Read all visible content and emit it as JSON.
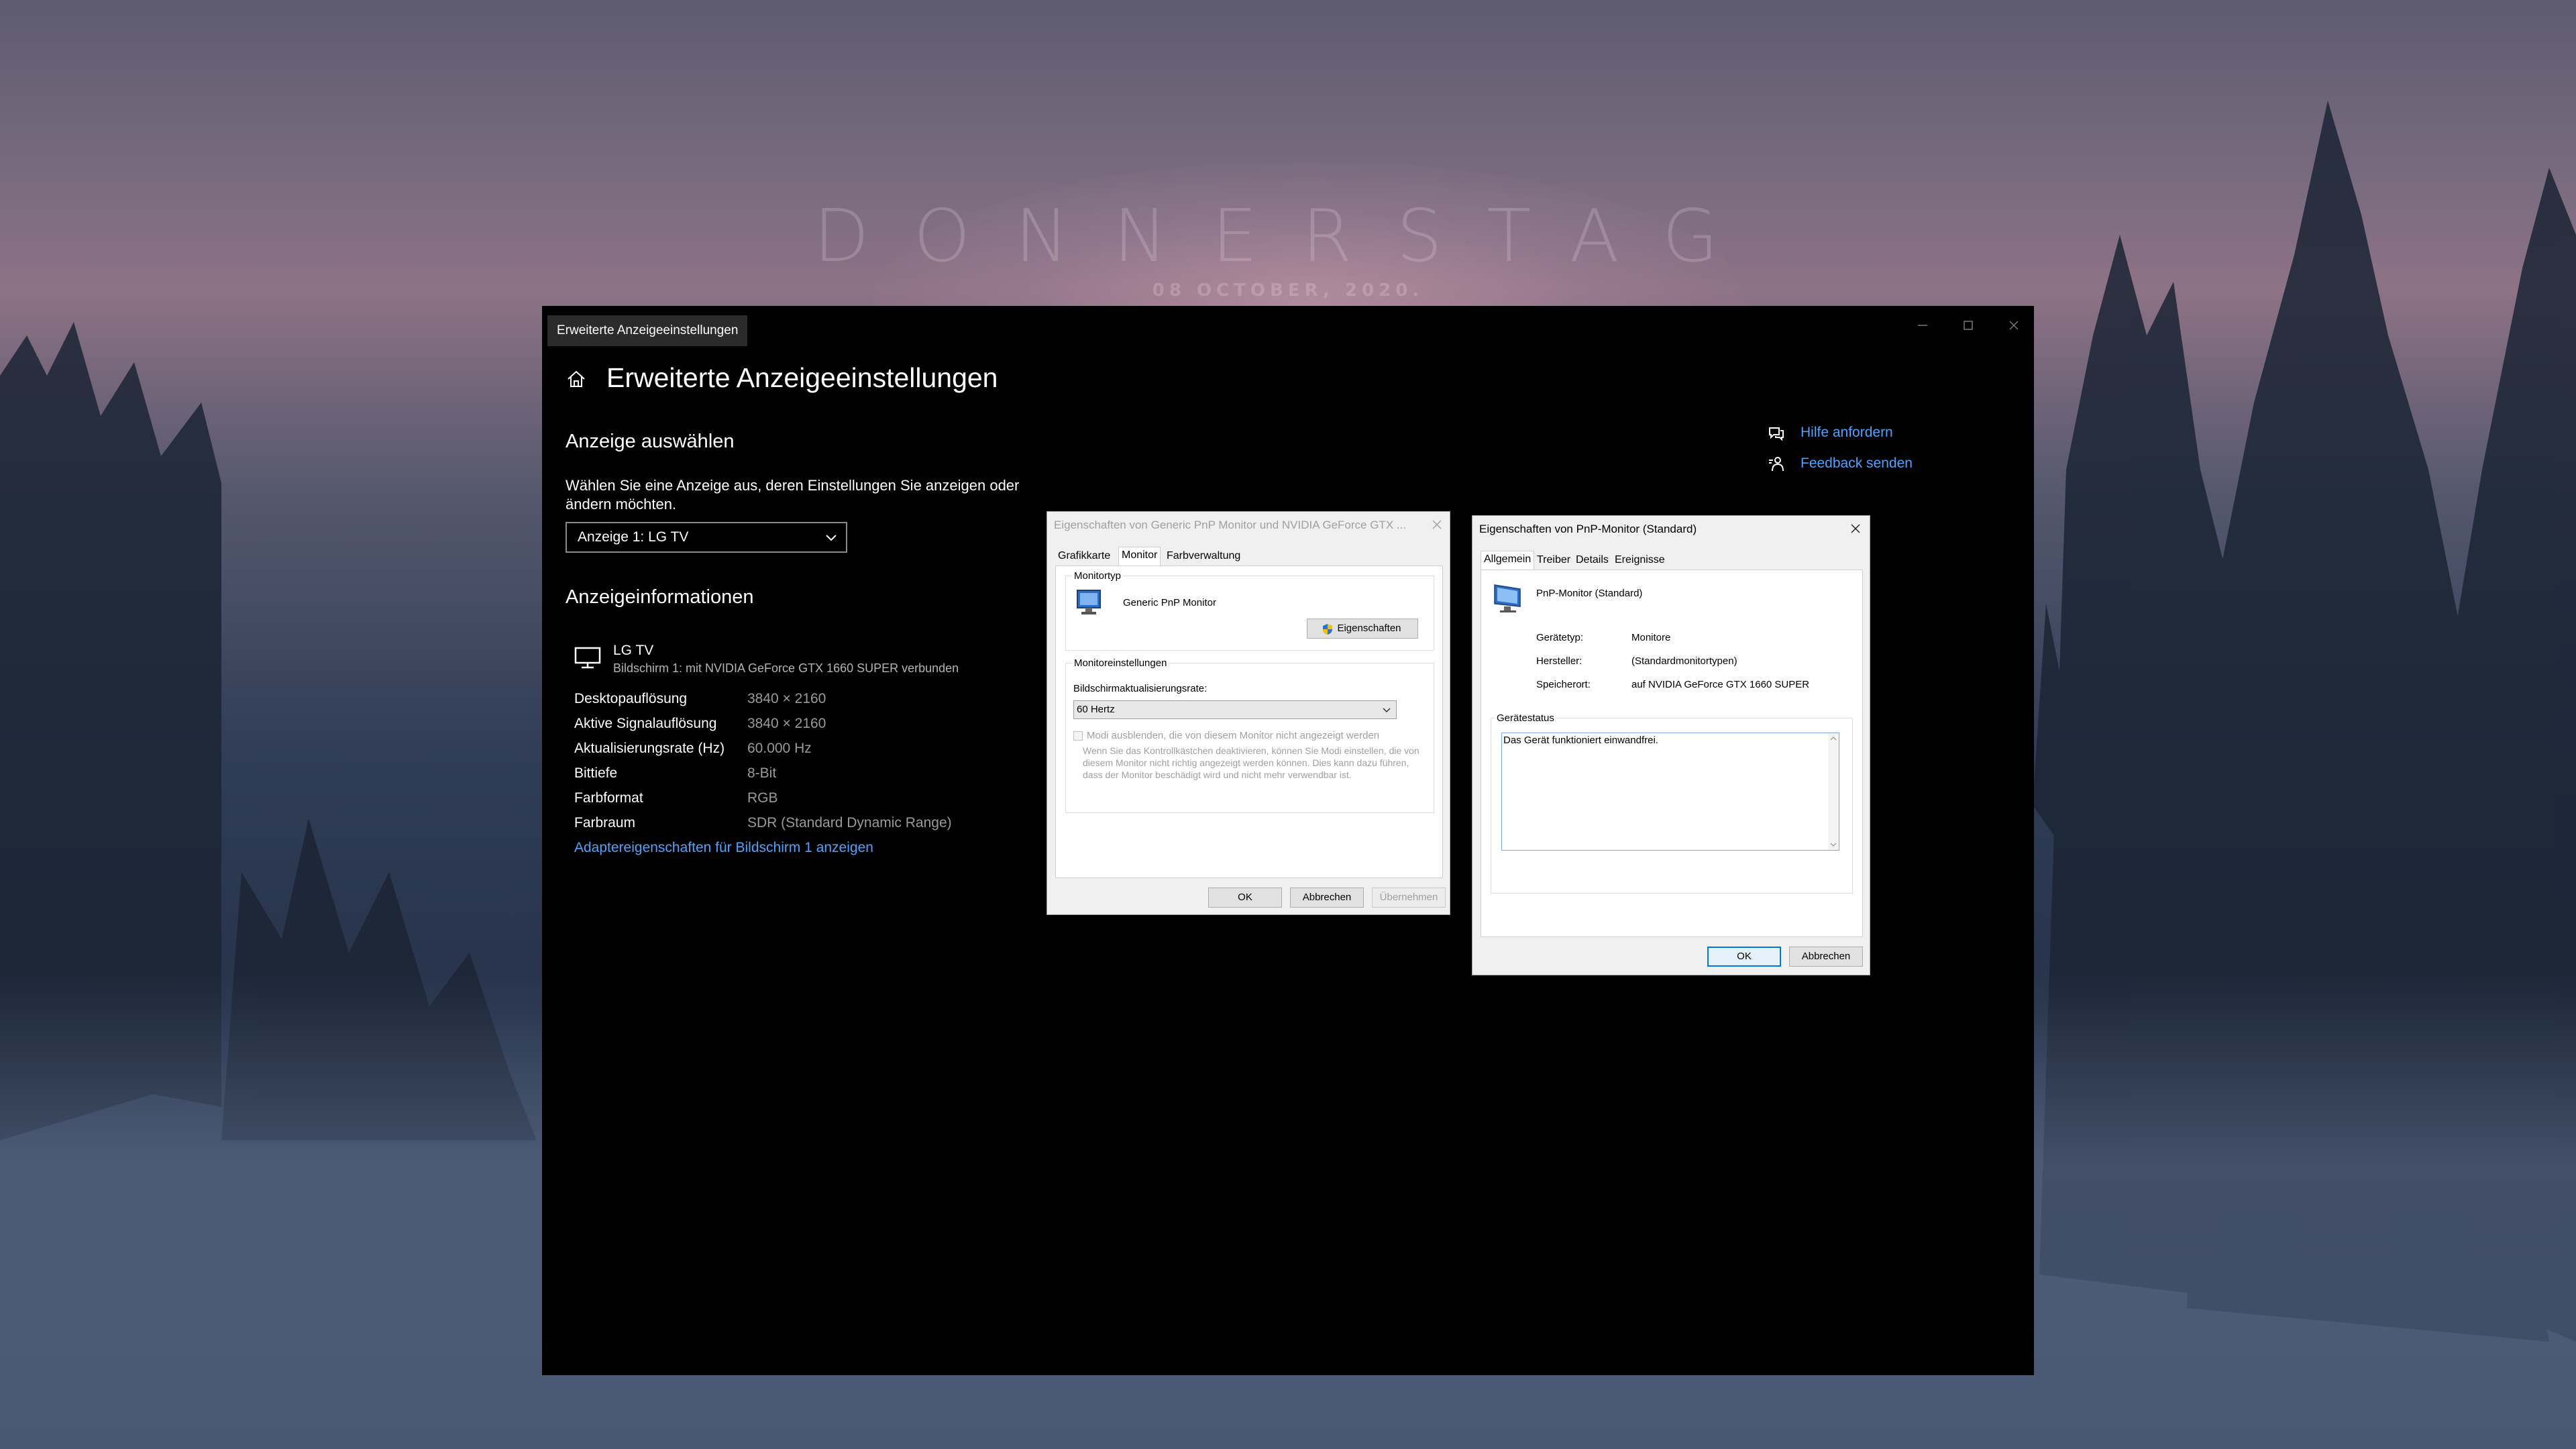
{
  "wallpaper": {
    "day": "DONNERSTAG",
    "date": "08 OCTOBER, 2020."
  },
  "settings": {
    "window_tab": "Erweiterte Anzeigeeinstellungen",
    "title": "Erweiterte Anzeigeeinstellungen",
    "select_heading": "Anzeige auswählen",
    "select_desc": "Wählen Sie eine Anzeige aus, deren Einstellungen Sie anzeigen oder ändern möchten.",
    "display_combo": "Anzeige 1: LG TV",
    "info_heading": "Anzeigeinformationen",
    "monitor_name": "LG TV",
    "monitor_sub": "Bildschirm 1: mit NVIDIA GeForce GTX 1660 SUPER verbunden",
    "info_rows": [
      {
        "key": "Desktopauflösung",
        "value": "3840 × 2160"
      },
      {
        "key": "Aktive Signalauflösung",
        "value": "3840 × 2160"
      },
      {
        "key": "Aktualisierungsrate (Hz)",
        "value": "60.000 Hz"
      },
      {
        "key": "Bittiefe",
        "value": "8-Bit"
      },
      {
        "key": "Farbformat",
        "value": "RGB"
      },
      {
        "key": "Farbraum",
        "value": "SDR (Standard Dynamic Range)"
      }
    ],
    "adapter_link": "Adaptereigenschaften für Bildschirm 1 anzeigen",
    "help_link": "Hilfe anfordern",
    "feedback_link": "Feedback senden",
    "accent_color": "#4da3ff"
  },
  "dialog_pnp": {
    "title": "Eigenschaften von Generic PnP Monitor und NVIDIA GeForce GTX ...",
    "tabs": [
      "Grafikkarte",
      "Monitor",
      "Farbverwaltung"
    ],
    "active_tab": "Monitor",
    "monitortype_label": "Monitortyp",
    "monitor_name": "Generic PnP Monitor",
    "properties_button": "Eigenschaften",
    "settings_label": "Monitoreinstellungen",
    "refresh_label": "Bildschirmaktualisierungsrate:",
    "refresh_value": "60 Hertz",
    "hide_modes_label": "Modi ausblenden, die von diesem Monitor nicht angezeigt werden",
    "hide_modes_help": "Wenn Sie das Kontrollkästchen deaktivieren, können Sie Modi einstellen, die von diesem Monitor nicht richtig angezeigt werden können. Dies kann dazu führen, dass der Monitor beschädigt wird und nicht mehr verwendbar ist.",
    "ok": "OK",
    "cancel": "Abbrechen",
    "apply": "Übernehmen"
  },
  "dialog_monitor": {
    "title": "Eigenschaften von PnP-Monitor (Standard)",
    "tabs": [
      "Allgemein",
      "Treiber",
      "Details",
      "Ereignisse"
    ],
    "active_tab": "Allgemein",
    "device_name": "PnP-Monitor (Standard)",
    "props": [
      {
        "key": "Gerätetyp:",
        "value": "Monitore"
      },
      {
        "key": "Hersteller:",
        "value": "(Standardmonitortypen)"
      },
      {
        "key": "Speicherort:",
        "value": "auf NVIDIA GeForce GTX 1660 SUPER"
      }
    ],
    "status_label": "Gerätestatus",
    "status_text": "Das Gerät funktioniert einwandfrei.",
    "ok": "OK",
    "cancel": "Abbrechen"
  }
}
